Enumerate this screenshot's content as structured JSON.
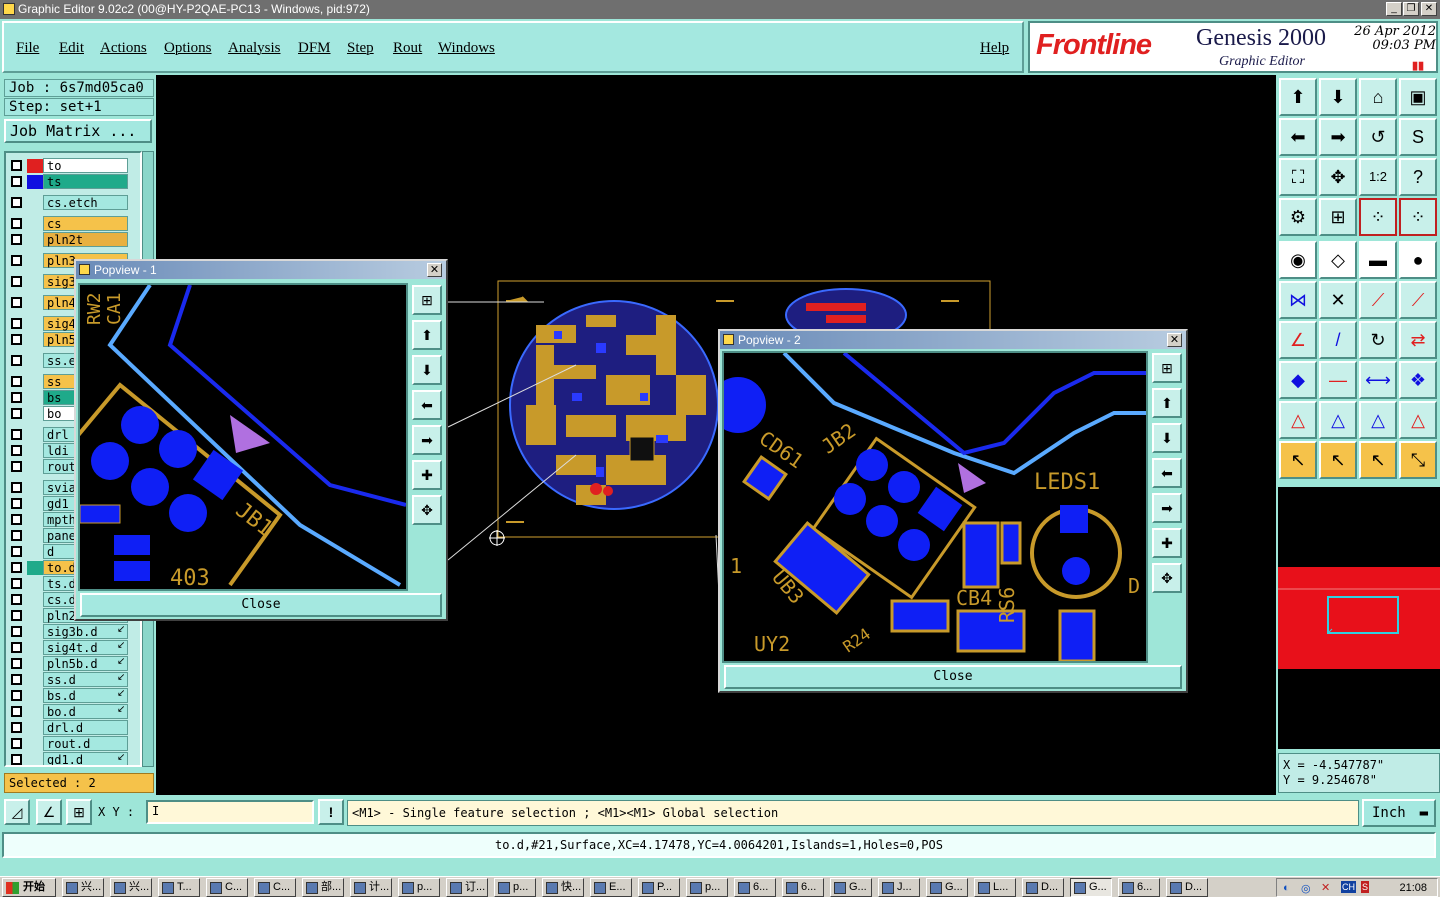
{
  "window": {
    "title": "Graphic Editor 9.02c2 (00@HY-P2QAE-PC13 - Windows, pid:972)"
  },
  "menu": [
    "File",
    "Edit",
    "Actions",
    "Options",
    "Analysis",
    "DFM",
    "Step",
    "Rout",
    "Windows"
  ],
  "help": "Help",
  "brand": {
    "logo": "Frontline",
    "product": "Genesis 2000",
    "subtitle": "Graphic Editor",
    "date": "26 Apr 2012",
    "time": "09:03 PM"
  },
  "job": {
    "label": "Job : 6s7md05ca0",
    "step": "Step: set+1",
    "matrix_button": "Job Matrix ..."
  },
  "layers": [
    {
      "name": "to",
      "color": "#ffffff",
      "swatch": "#e02020",
      "mark": ""
    },
    {
      "name": "ts",
      "color": "#1faa8a",
      "swatch": "#1010e0",
      "mark": ""
    },
    {
      "name": "cs.etch",
      "color": "#a4e8e0",
      "swatch": "",
      "mark": ""
    },
    {
      "name": "cs",
      "color": "#f5c24a",
      "swatch": "",
      "mark": ""
    },
    {
      "name": "pln2t",
      "color": "#e8b040",
      "swatch": "",
      "mark": ""
    },
    {
      "name": "pln3",
      "color": "#f5c24a",
      "swatch": "",
      "mark": ""
    },
    {
      "name": "sig3",
      "color": "#f5c24a",
      "swatch": "",
      "mark": ""
    },
    {
      "name": "pln4",
      "color": "#f5c24a",
      "swatch": "",
      "mark": ""
    },
    {
      "name": "sig4",
      "color": "#f5c24a",
      "swatch": "",
      "mark": ""
    },
    {
      "name": "pln5",
      "color": "#f5c24a",
      "swatch": "",
      "mark": ""
    },
    {
      "name": "ss.e",
      "color": "#a4e8e0",
      "swatch": "",
      "mark": ""
    },
    {
      "name": "ss",
      "color": "#f5c24a",
      "swatch": "",
      "mark": ""
    },
    {
      "name": "bs",
      "color": "#1faa8a",
      "swatch": "",
      "mark": ""
    },
    {
      "name": "bo",
      "color": "#ffffff",
      "swatch": "",
      "mark": ""
    },
    {
      "name": "drl",
      "color": "#a4e8e0",
      "swatch": "",
      "mark": ""
    },
    {
      "name": "ldi",
      "color": "#a4e8e0",
      "swatch": "",
      "mark": ""
    },
    {
      "name": "rout",
      "color": "#a4e8e0",
      "swatch": "",
      "mark": ""
    },
    {
      "name": "svia",
      "color": "#a4e8e0",
      "swatch": "",
      "mark": ""
    },
    {
      "name": "gd1",
      "color": "#a4e8e0",
      "swatch": "",
      "mark": ""
    },
    {
      "name": "mpth",
      "color": "#a4e8e0",
      "swatch": "",
      "mark": ""
    },
    {
      "name": "pane",
      "color": "#a4e8e0",
      "swatch": "",
      "mark": ""
    },
    {
      "name": "d",
      "color": "#a4e8e0",
      "swatch": "",
      "mark": ""
    },
    {
      "name": "to.d",
      "color": "#f5c24a",
      "swatch": "#1faa8a",
      "mark": ""
    },
    {
      "name": "ts.d",
      "color": "#a4e8e0",
      "swatch": "",
      "mark": ""
    },
    {
      "name": "cs.d",
      "color": "#a4e8e0",
      "swatch": "",
      "mark": ""
    },
    {
      "name": "pln2",
      "color": "#a4e8e0",
      "swatch": "",
      "mark": ""
    },
    {
      "name": "sig3b.d",
      "color": "#a4e8e0",
      "swatch": "",
      "mark": "↙"
    },
    {
      "name": "sig4t.d",
      "color": "#a4e8e0",
      "swatch": "",
      "mark": "↙"
    },
    {
      "name": "pln5b.d",
      "color": "#a4e8e0",
      "swatch": "",
      "mark": "↙"
    },
    {
      "name": "ss.d",
      "color": "#a4e8e0",
      "swatch": "",
      "mark": "↙"
    },
    {
      "name": "bs.d",
      "color": "#a4e8e0",
      "swatch": "",
      "mark": "↙"
    },
    {
      "name": "bo.d",
      "color": "#a4e8e0",
      "swatch": "",
      "mark": "↙"
    },
    {
      "name": "drl.d",
      "color": "#a4e8e0",
      "swatch": "",
      "mark": ""
    },
    {
      "name": "rout.d",
      "color": "#a4e8e0",
      "swatch": "",
      "mark": ""
    },
    {
      "name": "gd1.d",
      "color": "#a4e8e0",
      "swatch": "",
      "mark": "↙"
    }
  ],
  "selected": "Selected : 2",
  "popview1": {
    "title": "Popview - 1",
    "close": "Close",
    "labels": [
      "JB1",
      "RW2",
      "CA1",
      "403"
    ]
  },
  "popview2": {
    "title": "Popview - 2",
    "close": "Close",
    "labels": [
      "CD61",
      "JB2",
      "LEDS1",
      "UB3",
      "UY2",
      "CB4",
      "RS6",
      "1",
      "D",
      "R24"
    ]
  },
  "cmd": {
    "xy_label": "X Y :",
    "prompt": "<M1> - Single feature selection ; <M1><M1> Global selection",
    "unit": "Inch"
  },
  "coords": {
    "x": "X = -4.547787\"",
    "y": "Y = 9.254678\""
  },
  "status": "to.d,#21,Surface,XC=4.17478,YC=4.0064201,Islands=1,Holes=0,POS",
  "taskbar": {
    "start": "开始",
    "tasks": [
      "兴...",
      "兴...",
      "T...",
      "C...",
      "C...",
      "部...",
      "计...",
      "p...",
      "订...",
      "p...",
      "快...",
      "E...",
      "P...",
      "p...",
      "6...",
      "6...",
      "G...",
      "J...",
      "G...",
      "L...",
      "D...",
      "G...",
      "6...",
      "D..."
    ],
    "clock": "21:08"
  }
}
